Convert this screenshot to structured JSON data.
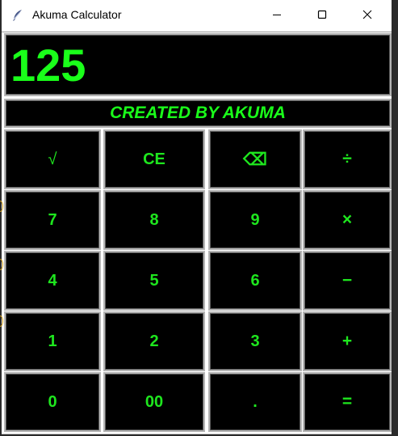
{
  "window": {
    "title": "Akuma Calculator",
    "icon": "feather-icon"
  },
  "titlebar_buttons": {
    "minimize": "minimize-icon",
    "maximize": "maximize-icon",
    "close": "close-icon"
  },
  "display": {
    "value": "125"
  },
  "banner": {
    "text": "CREATED BY AKUMA"
  },
  "buttons": [
    {
      "label": "√",
      "name": "sqrt-button"
    },
    {
      "label": "CE",
      "name": "clear-entry-button"
    },
    {
      "label": "⌫",
      "name": "backspace-button"
    },
    {
      "label": "÷",
      "name": "divide-button"
    },
    {
      "label": "7",
      "name": "digit-7-button"
    },
    {
      "label": "8",
      "name": "digit-8-button"
    },
    {
      "label": "9",
      "name": "digit-9-button"
    },
    {
      "label": "×",
      "name": "multiply-button"
    },
    {
      "label": "4",
      "name": "digit-4-button"
    },
    {
      "label": "5",
      "name": "digit-5-button"
    },
    {
      "label": "6",
      "name": "digit-6-button"
    },
    {
      "label": "−",
      "name": "subtract-button"
    },
    {
      "label": "1",
      "name": "digit-1-button"
    },
    {
      "label": "2",
      "name": "digit-2-button"
    },
    {
      "label": "3",
      "name": "digit-3-button"
    },
    {
      "label": "+",
      "name": "add-button"
    },
    {
      "label": "0",
      "name": "digit-0-button"
    },
    {
      "label": "00",
      "name": "double-zero-button"
    },
    {
      "label": ".",
      "name": "decimal-button"
    },
    {
      "label": "=",
      "name": "equals-button"
    }
  ],
  "colors": {
    "foreground": "#1aff1a",
    "background": "#000000",
    "border": "#b5b5b5"
  }
}
